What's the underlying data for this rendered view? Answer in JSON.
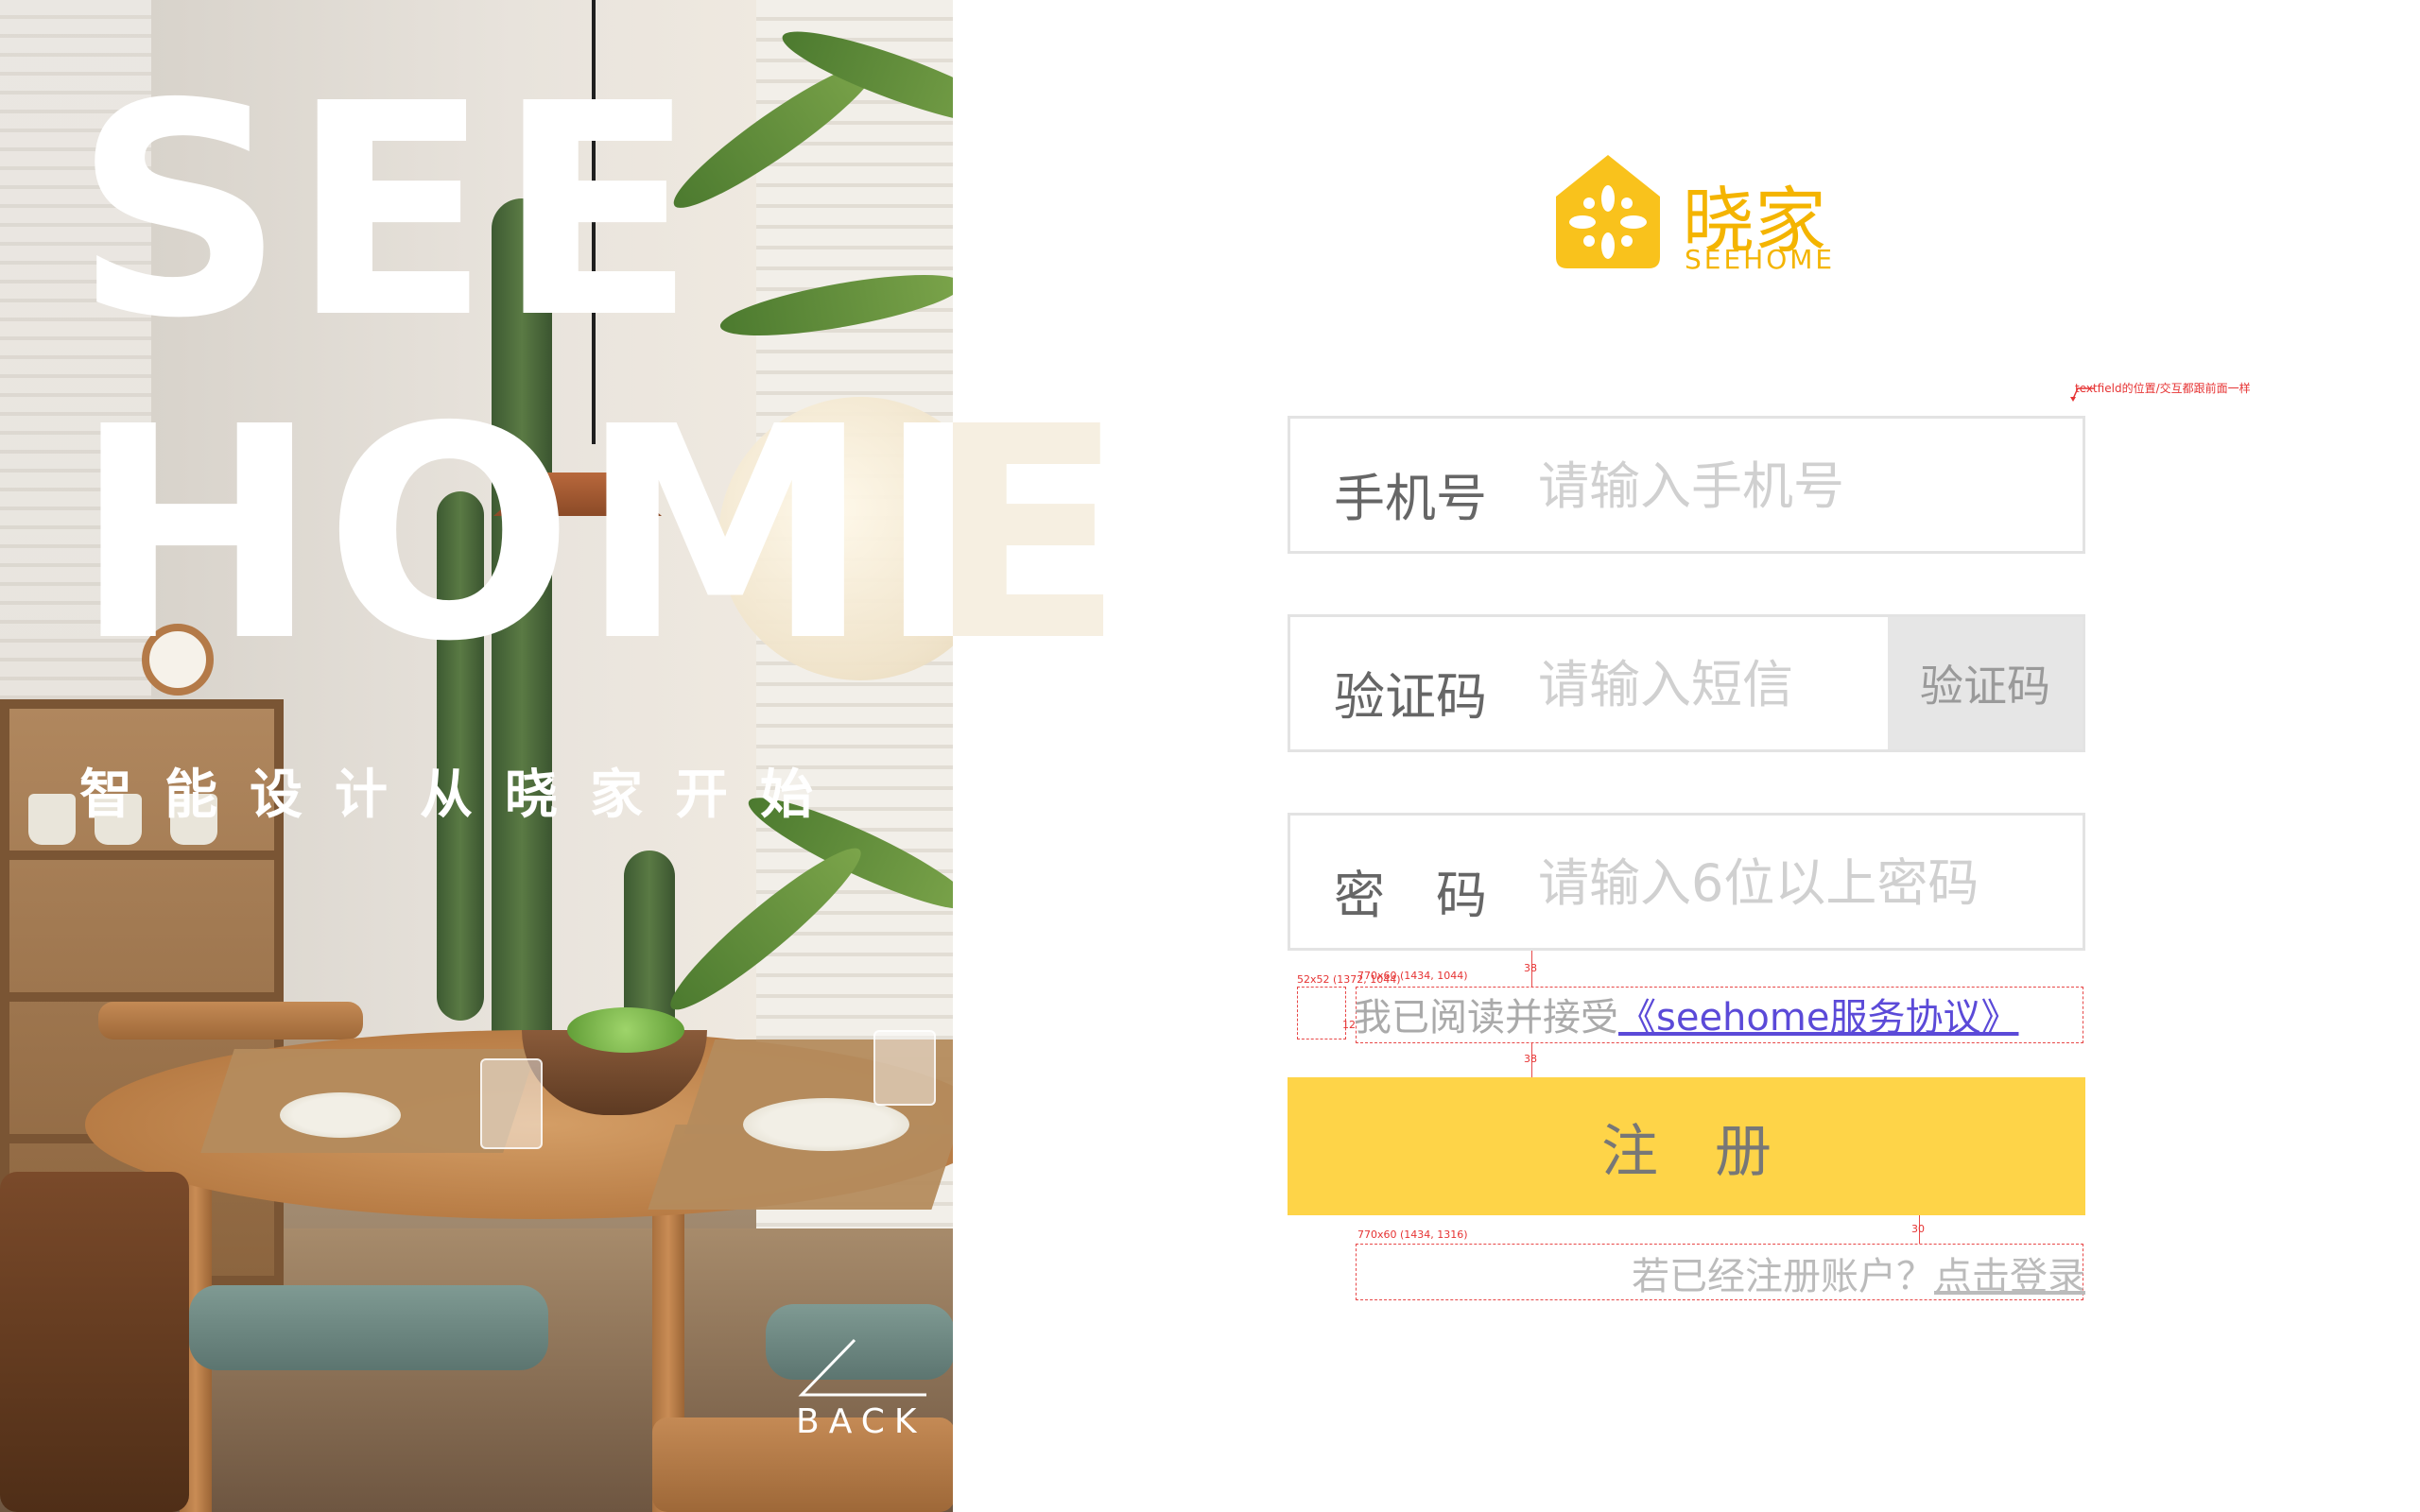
{
  "hero": {
    "big_word_1": "SEE",
    "big_word_2": "HOME",
    "ghost_letter": "E",
    "slogan": "智能设计从晓家开始",
    "back_label": "BACK"
  },
  "brand": {
    "name_cn": "晓家",
    "name_en": "SEEHOME",
    "color": "#f4b400"
  },
  "annotation_note": "textfield的位置/交互都跟前面一样",
  "form": {
    "phone": {
      "label": "手机号",
      "placeholder": "请输入手机号"
    },
    "code": {
      "label": "验证码",
      "placeholder": "请输入短信",
      "button": "验证码"
    },
    "password": {
      "label": "密　码",
      "placeholder": "请输入6位以上密码"
    },
    "agreement": {
      "prefix": "我已阅读并接受",
      "link": "《seehome服务协议》"
    },
    "submit_label": "注册",
    "login_prompt": "若已经注册账户？",
    "login_link": "点击登录",
    "accent_color": "#fed448",
    "link_color": "#5b4ad8"
  },
  "spec_labels": {
    "checkbox_size": "52x52 (1372, 1044)",
    "agree_box": "770x60 (1434, 1044)",
    "gap_top": "38",
    "gap_bottom": "38",
    "gap_mid": "12",
    "login_box": "770x60 (1434, 1316)",
    "gap_login": "30"
  }
}
